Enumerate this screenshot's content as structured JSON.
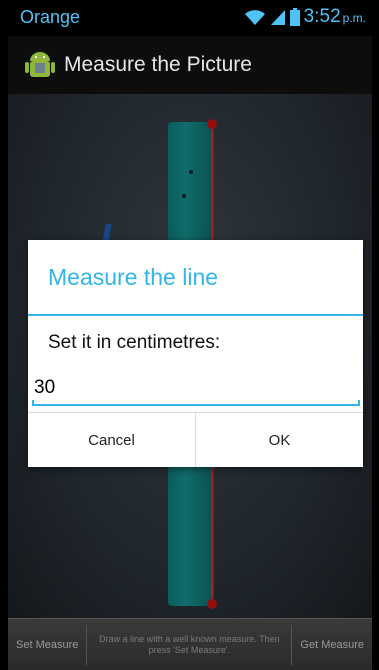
{
  "status_bar": {
    "carrier": "Orange",
    "time": "3:52",
    "ampm": "p.m."
  },
  "action_bar": {
    "title": "Measure the Picture",
    "icon": "android-icon"
  },
  "bottom_bar": {
    "left_button": "Set Measure",
    "hint": "Draw a line with a well known measure. Then press 'Set Measure'.",
    "right_button": "Get Measure"
  },
  "dialog": {
    "title": "Measure the line",
    "message": "Set it in centimetres:",
    "input_value": "30",
    "cancel_label": "Cancel",
    "ok_label": "OK"
  },
  "colors": {
    "accent": "#33b5e5",
    "line": "#ff2a2a"
  }
}
